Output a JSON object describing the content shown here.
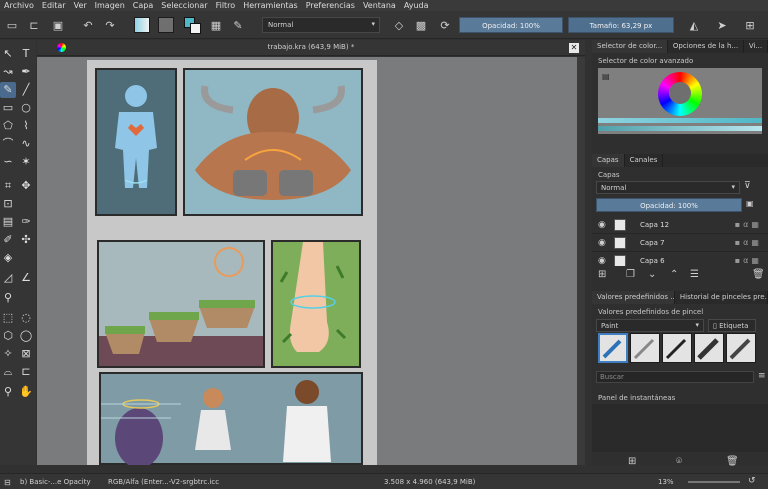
{
  "menu": [
    "Archivo",
    "Editar",
    "Ver",
    "Imagen",
    "Capa",
    "Seleccionar",
    "Filtro",
    "Herramientas",
    "Preferencias",
    "Ventana",
    "Ayuda"
  ],
  "toolbar": {
    "blend_mode": "Normal",
    "opacity_label": "Opacidad: 100%",
    "size_label": "Tamaño: 63,29 px"
  },
  "document": {
    "title": "trabajo.kra (643,9 MiB) *"
  },
  "colors": {
    "accent": "#4a6b8d",
    "slider": "#5a7a9a",
    "canvas_bg": "#7a7b7c"
  },
  "docker": {
    "color_tabs": [
      "Selector de color...",
      "Opciones de la h...",
      "Vi..."
    ],
    "color_title": "Selector de color avanzado",
    "layer_tabs": [
      "Capas",
      "Canales"
    ],
    "layers_title": "Capas",
    "layers_blend": "Normal",
    "layers_opacity": "Opacidad:  100%",
    "layers": [
      {
        "name": "Capa 12"
      },
      {
        "name": "Capa 7"
      },
      {
        "name": "Capa 6"
      }
    ],
    "presets_tabs": [
      "Valores predefinidos ...",
      "Historial de pinceles pre..."
    ],
    "presets_title": "Valores predefinidos de pincel",
    "presets_filter": "Paint",
    "presets_tag": "Etiqueta",
    "search_placeholder": "Buscar",
    "snapshots_title": "Panel de instantáneas"
  },
  "status": {
    "brush": "b) Basic-...e Opacity",
    "colorspace": "RGB/Alfa (Enter...-V2-srgbtrc.icc",
    "dimensions": "3.508 x 4.960 (643,9 MiB)",
    "zoom": "13%"
  }
}
